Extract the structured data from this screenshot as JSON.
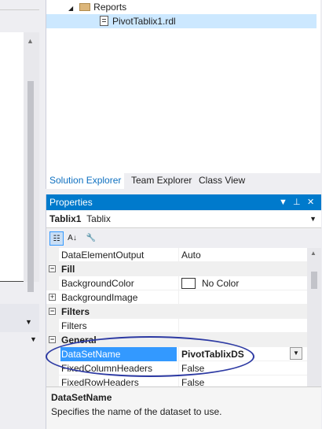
{
  "solution_explorer": {
    "tree": [
      {
        "label": "Reports",
        "type": "folder",
        "expanded": true
      },
      {
        "label": "PivotTablix1.rdl",
        "type": "file",
        "selected": true
      }
    ],
    "tabs": [
      "Solution Explorer",
      "Team Explorer",
      "Class View"
    ],
    "active_tab": "Solution Explorer"
  },
  "properties": {
    "title": "Properties",
    "object_name": "Tablix1",
    "object_type": "Tablix",
    "rows": [
      {
        "kind": "prop",
        "name": "DataElementOutput",
        "value": "Auto"
      },
      {
        "kind": "cat",
        "name": "Fill"
      },
      {
        "kind": "prop",
        "name": "BackgroundColor",
        "value": "No Color",
        "swatch": true
      },
      {
        "kind": "prop",
        "name": "BackgroundImage",
        "value": "",
        "expandable": true
      },
      {
        "kind": "cat",
        "name": "Filters"
      },
      {
        "kind": "prop",
        "name": "Filters",
        "value": ""
      },
      {
        "kind": "cat",
        "name": "General"
      },
      {
        "kind": "prop",
        "name": "DataSetName",
        "value": "PivotTablixDS",
        "selected": true
      },
      {
        "kind": "prop",
        "name": "FixedColumnHeaders",
        "value": "False"
      },
      {
        "kind": "prop",
        "name": "FixedRowHeaders",
        "value": "False"
      }
    ],
    "description": {
      "title": "DataSetName",
      "text": "Specifies the name of the dataset to use."
    }
  },
  "colors": {
    "accent": "#007acc",
    "selection": "#3399ff",
    "annotation": "#2d3aa3"
  }
}
